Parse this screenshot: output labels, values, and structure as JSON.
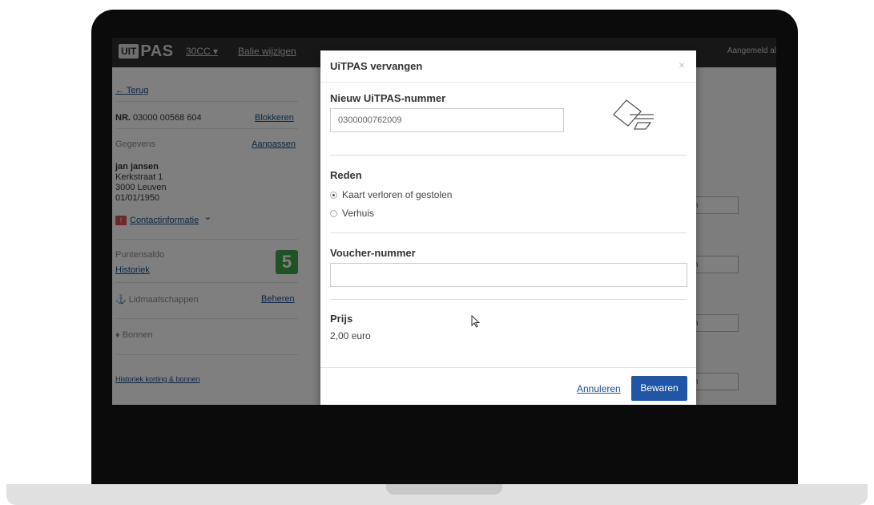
{
  "app": {
    "logo_box": "UIT",
    "logo_text": "PAS",
    "nav_counter": "30CC ▾",
    "nav_link": "Balie wijzigen",
    "user": "Aangemeld al"
  },
  "sidebar": {
    "back": "← Terug",
    "nr_label": "NR.",
    "nr_value": "03000 00568 604",
    "block": "Blokkeren",
    "details_label": "Gegevens",
    "edit": "Aanpassen",
    "name": "jan jansen",
    "street": "Kerkstraat 1",
    "city": "3000 Leuven",
    "birthdate": "01/01/1950",
    "warn_icon": "!",
    "contact": "Contactinformatie",
    "contact_chevron": "⌄",
    "points_label": "Puntensaldo",
    "points_value": "5",
    "history": "Historiek",
    "memberships": "Lidmaatschappen",
    "memberships_icon": "⚓",
    "manage": "Beheren",
    "vouchers": "Bonnen",
    "vouchers_icon": "♦",
    "history_discount": "Historiek korting & bonnen"
  },
  "background_buttons": [
    "ren",
    "ren",
    "ren",
    "ren"
  ],
  "modal": {
    "title": "UiTPAS vervangen",
    "close": "×",
    "new_number_label": "Nieuw UiTPAS-nummer",
    "new_number_value": "0300000762009",
    "reason_label": "Reden",
    "reasons": [
      {
        "label": "Kaart verloren of gestolen",
        "selected": true
      },
      {
        "label": "Verhuis",
        "selected": false
      }
    ],
    "voucher_label": "Voucher-nummer",
    "voucher_value": "",
    "price_label": "Prijs",
    "price_value": "2,00 euro",
    "cancel": "Annuleren",
    "save": "Bewaren"
  },
  "colors": {
    "primary": "#1f55a4",
    "link": "#1a4f8b",
    "points_badge": "#3fa64a",
    "warning": "#d9534f",
    "topbar": "#2f2f2f"
  }
}
